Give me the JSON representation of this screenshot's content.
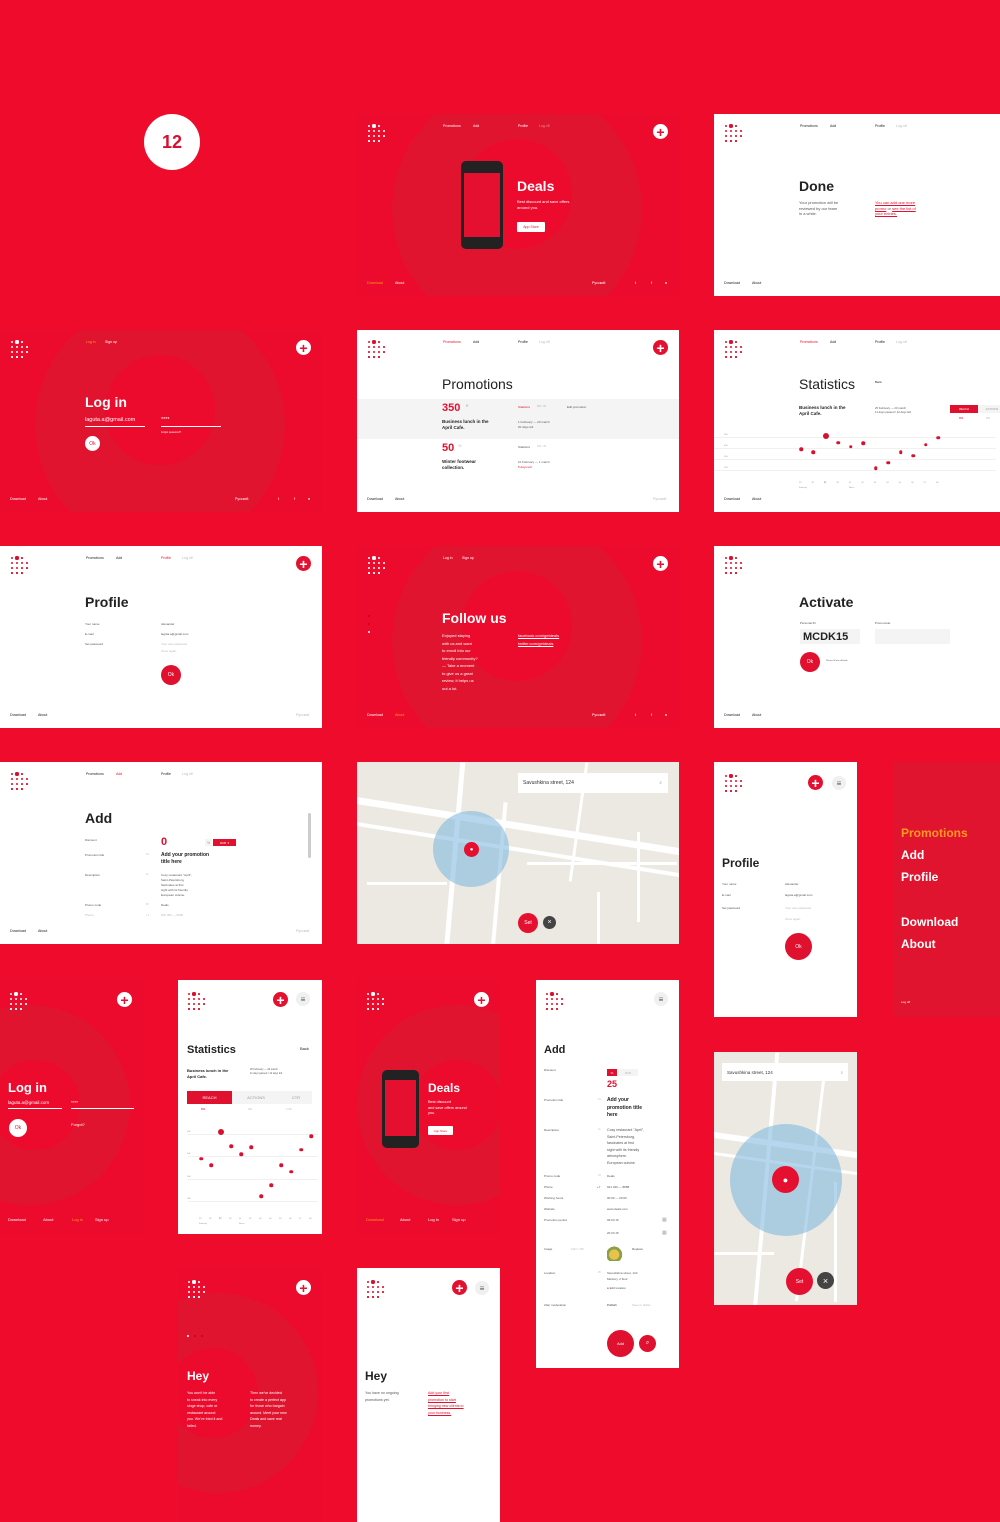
{
  "badge": {
    "number": "12"
  },
  "colors": {
    "brand_red": "#ec0a2d",
    "accent_orange": "#ff9a1f",
    "text_dark": "#222222"
  },
  "nav": {
    "promotions": "Promotions",
    "add": "Add",
    "profile": "Profile",
    "logoff": "Log off",
    "login": "Log in",
    "signup": "Sign up",
    "download": "Download",
    "about": "About",
    "language": "Русский"
  },
  "deals": {
    "title": "Deals",
    "subtitle_l1": "Best discount and save offers",
    "subtitle_l2": "around you.",
    "appstore": "App Store"
  },
  "done": {
    "title": "Done",
    "text_l1": "Your promotion will be",
    "text_l2": "reviewed by our team",
    "text_l3": "in a while.",
    "link_l1": "You can add one more",
    "link_l2a": "promo",
    "link_l2b": " or ",
    "link_l2c": "see the list of",
    "link_l3": "your entries."
  },
  "login": {
    "title": "Log in",
    "email": "laguta.a@gmail.com",
    "password": "****",
    "forgot": "Forgot password?",
    "forgot_short": "Forgot?",
    "ok": "Ok"
  },
  "promotions": {
    "title": "Promotions",
    "items": [
      {
        "value": "350",
        "unit": "₽",
        "name_l1": "Business lunch in the",
        "name_l2": "April Cafe.",
        "stats": "Statistics",
        "stats_count": "850 / 86",
        "edit": "Edit promotion",
        "dates": "1 February — 20 march",
        "left": "20 days left"
      },
      {
        "value": "50",
        "unit": "%",
        "name_l1": "Winter footwear",
        "name_l2": "collection.",
        "stats": "Statistics",
        "stats_count": "463 / 45",
        "edit": "",
        "dates": "10 February — 1 march",
        "left": "5 days left"
      }
    ]
  },
  "statistics": {
    "title": "Statistics",
    "back": "Back",
    "promo_l1": "Business lunch in the",
    "promo_l2": "April Cafe.",
    "dates": "25 February — 20 march",
    "progress": "11 days passed / 12 days left",
    "tabs": [
      {
        "label": "REACH",
        "value": "852",
        "active": true
      },
      {
        "label": "ACTIONS",
        "value": "391",
        "active": false
      },
      {
        "label": "CTR",
        "value": "2.4%",
        "active": false
      }
    ],
    "month_feb": "February",
    "month_mar": "March"
  },
  "chart_data": {
    "type": "scatter",
    "title": "Reach",
    "xlabel": "",
    "ylabel": "",
    "x": [
      "25",
      "26",
      "27",
      "28",
      "01",
      "02",
      "03",
      "04",
      "05",
      "06",
      "07",
      "08"
    ],
    "values": [
      390,
      360,
      510,
      445,
      410,
      440,
      220,
      270,
      360,
      330,
      430,
      490
    ],
    "highlight_index": 2,
    "yticks": [
      "500",
      "400",
      "300",
      "200"
    ],
    "ylim": [
      150,
      550
    ],
    "grid": true
  },
  "profile": {
    "title": "Profile",
    "name_label": "Your name",
    "name_value": "Alexander",
    "email_label": "E-mail",
    "email_value": "laguta.a@gmail.com",
    "password_label": "Set password",
    "password_placeholder": "Your new password",
    "password_again": "Once again",
    "ok": "Ok"
  },
  "follow": {
    "title": "Follow us",
    "text": [
      "Enjoyed staying",
      "with us and want",
      "to enroll into our",
      "friendly community?",
      "— Take a moment",
      "to give us a great",
      "review, it helps us",
      "out a lot."
    ],
    "facebook": "facebook.com/getdeals",
    "twitter": "twitter.com/getdeals"
  },
  "activate": {
    "title": "Activate",
    "personal_label": "Personal ID",
    "personal_value": "MCDK15",
    "promocode_label": "Promocode",
    "promocode_value": "",
    "ok": "Ok",
    "hint": "Please fill out all fields"
  },
  "add": {
    "title": "Add",
    "discount_label": "Discount",
    "discount_value": "0",
    "discount_value_mobile": "25",
    "currency": "RUB",
    "percent": "%",
    "title_label": "Promotion title",
    "title_count": "21",
    "title_placeholder_l1": "Add your promotion",
    "title_placeholder_l2": "title here",
    "mtitle_l1": "Add your",
    "mtitle_l2": "promotion title",
    "mtitle_l3": "here",
    "desc_label": "Description",
    "desc_count": "11",
    "desc_lines": [
      "Cosy restaurant \"April\",",
      "Saint-Petersburg,",
      "fascinates at first",
      "sight with its friendly",
      "atmosphere.",
      "European cuisine."
    ],
    "promo_label": "Promo code",
    "promo_count": "15",
    "promo_value": "Deals",
    "phone_label": "Phone",
    "phone_prefix": "+7",
    "phone_value": "921   320  —  8888",
    "phone_placeholder": "000   000  —  0000",
    "hours_label": "Working hours",
    "hours_value": "00:00  —  00:00",
    "website_label": "Website",
    "website_value": "www.deals.com",
    "period_label": "Promotion period",
    "period_start": "09.03.15",
    "period_end": "20.03.15",
    "image_label": "Image",
    "image_size": "1024 × 768",
    "image_replace": "Replace",
    "location_label": "Location",
    "location_count": "25",
    "location_l1": "Savushkina street, 124",
    "location_l2": "Merkury, 2 flour",
    "location_edit": "Edit location",
    "moderation_label": "After moderation",
    "publish": "Publish",
    "save_drafts": "Save in drafts",
    "add_button": "Add"
  },
  "map": {
    "search_value": "Savushkina street, 124",
    "set": "Set"
  },
  "menu": {
    "items": [
      "Promotions",
      "Add",
      "Profile",
      "Download",
      "About"
    ],
    "logoff": "Log off"
  },
  "hey": {
    "title": "Hey",
    "red_col1": [
      "You won't be able",
      "to sneak into every",
      "singe shop, cafe or",
      "restaurant around",
      "you. We've tried it and",
      "failed."
    ],
    "red_col2": [
      "Then we've decided",
      "to create a perfect app",
      "for those who bargain",
      "around. Meet your new",
      "Deals and save real",
      "money."
    ],
    "white_text": [
      "You have no ongoing",
      "promotions yet."
    ],
    "white_link": [
      "Add your first",
      "promotion to start",
      "bringing new clients to",
      "your business."
    ]
  }
}
